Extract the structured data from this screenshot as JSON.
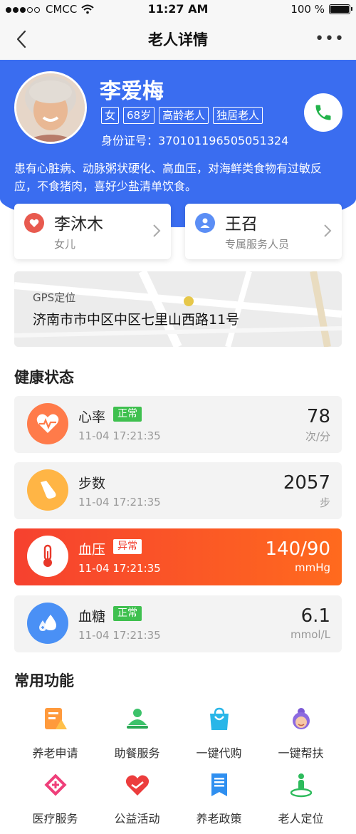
{
  "status_bar": {
    "carrier": "CMCC",
    "time": "11:27 AM",
    "battery": "100 %"
  },
  "nav": {
    "title": "老人详情"
  },
  "profile": {
    "name": "李爱梅",
    "tags": [
      "女",
      "68岁",
      "高龄老人",
      "独居老人"
    ],
    "id_label": "身份证号：",
    "id_number": "370101196505051324",
    "description": "患有心脏病、动脉粥状硬化、高血压，对海鲜类食物有过敏反应，不食猪肉，喜好少盐清单饮食。"
  },
  "contacts": [
    {
      "name": "李沐木",
      "role": "女儿",
      "color": "#e85a4f"
    },
    {
      "name": "王召",
      "role": "专属服务人员",
      "color": "#5b8ef5"
    }
  ],
  "location": {
    "label": "GPS定位",
    "address": "济南市市中区中区七里山西路11号"
  },
  "health": {
    "title": "健康状态",
    "items": [
      {
        "name": "心率",
        "status": "正常",
        "time": "11-04   17:21:35",
        "value": "78",
        "unit": "次/分",
        "icon": "heart-rate-icon",
        "color": "#ff7b4a"
      },
      {
        "name": "步数",
        "status": "",
        "time": "11-04   17:21:35",
        "value": "2057",
        "unit": "步",
        "icon": "shoe-icon",
        "color": "#ffb545"
      },
      {
        "name": "血压",
        "status": "异常",
        "time": "11-04   17:21:35",
        "value": "140/90",
        "unit": "mmHg",
        "icon": "thermometer-icon",
        "color": "#ffffff"
      },
      {
        "name": "血糖",
        "status": "正常",
        "time": "11-04   17:21:35",
        "value": "6.1",
        "unit": "mmol/L",
        "icon": "blood-drop-icon",
        "color": "#4a90f5"
      }
    ]
  },
  "functions": {
    "title": "常用功能",
    "items": [
      {
        "label": "养老申请",
        "icon": "application-form-icon"
      },
      {
        "label": "助餐服务",
        "icon": "meal-service-icon"
      },
      {
        "label": "一键代购",
        "icon": "shopping-bag-icon"
      },
      {
        "label": "一键帮扶",
        "icon": "elder-help-icon"
      },
      {
        "label": "医疗服务",
        "icon": "medical-cross-icon"
      },
      {
        "label": "公益活动",
        "icon": "charity-heart-icon"
      },
      {
        "label": "养老政策",
        "icon": "policy-document-icon"
      },
      {
        "label": "老人定位",
        "icon": "location-person-icon"
      }
    ]
  }
}
